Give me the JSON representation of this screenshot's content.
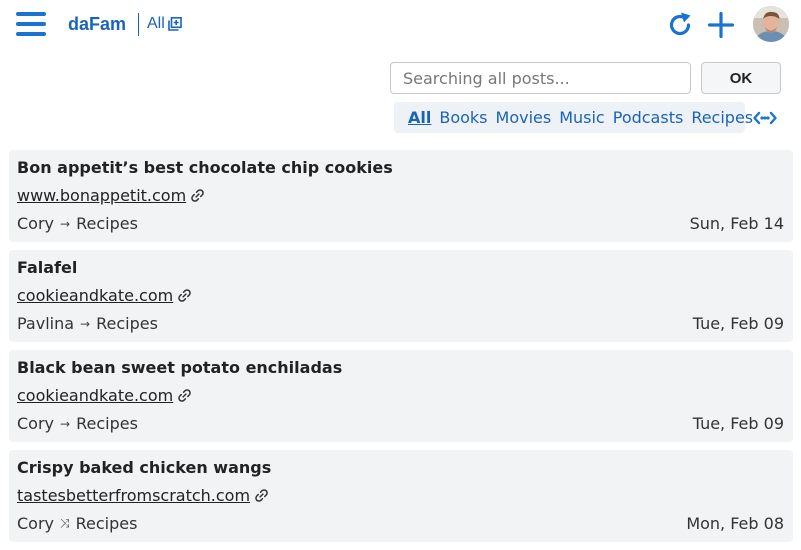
{
  "header": {
    "brand": "daFam",
    "scope_label": "All",
    "colors": {
      "accent": "#1a73d1",
      "brand": "#1a64b8"
    }
  },
  "search": {
    "placeholder": "Searching all posts...",
    "value": "",
    "submit_label": "OK"
  },
  "filters": [
    {
      "label": "All",
      "active": true
    },
    {
      "label": "Books"
    },
    {
      "label": "Movies"
    },
    {
      "label": "Music"
    },
    {
      "label": "Podcasts"
    },
    {
      "label": "Recipes"
    }
  ],
  "posts": [
    {
      "title": "Bon appetit’s best chocolate chip cookies",
      "domain": "www.bonappetit.com",
      "author": "Cory",
      "relation_icon": "arrow-right-icon",
      "category": "Recipes",
      "date": "Sun, Feb 14"
    },
    {
      "title": "Falafel",
      "domain": "cookieandkate.com",
      "author": "Pavlina",
      "relation_icon": "arrow-right-icon",
      "category": "Recipes",
      "date": "Tue, Feb 09"
    },
    {
      "title": "Black bean sweet potato enchiladas",
      "domain": "cookieandkate.com",
      "author": "Cory",
      "relation_icon": "arrow-right-icon",
      "category": "Recipes",
      "date": "Tue, Feb 09"
    },
    {
      "title": "Crispy baked chicken wangs",
      "domain": "tastesbetterfromscratch.com",
      "author": "Cory",
      "relation_icon": "shuffle-icon",
      "category": "Recipes",
      "date": "Mon, Feb 08"
    }
  ],
  "icons": {
    "menu": "hamburger-menu-icon",
    "scope": "external-window-icon",
    "refresh": "refresh-icon",
    "add": "plus-icon",
    "more_filters": "code-dots-icon",
    "link": "link-chain-icon"
  },
  "arrows": {
    "arrow-right-icon": "→",
    "shuffle-icon": "⤨"
  }
}
